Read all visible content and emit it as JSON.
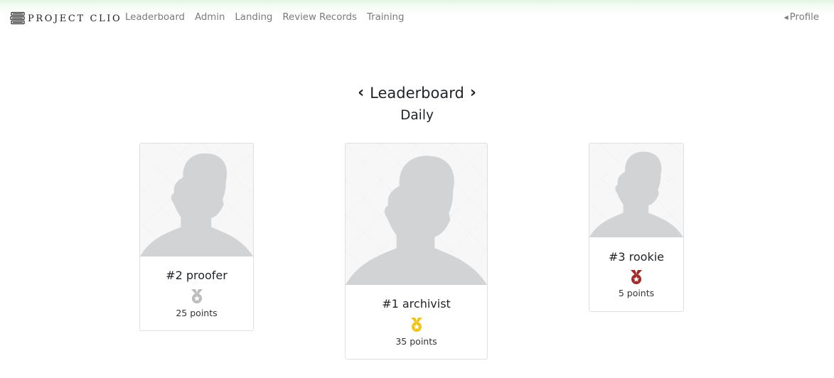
{
  "nav": {
    "brand": "PROJECT CLIO",
    "links": [
      "Leaderboard",
      "Admin",
      "Landing",
      "Review Records",
      "Training"
    ],
    "profile": "Profile"
  },
  "main": {
    "title": "Leaderboard",
    "subtitle": "Daily"
  },
  "leaderboard": [
    {
      "rank_label": "#2 proofer",
      "points_label": "25 points",
      "medal_color": "#bbbbbb"
    },
    {
      "rank_label": "#1 archivist",
      "points_label": "35 points",
      "medal_color": "#f0c419"
    },
    {
      "rank_label": "#3 rookie",
      "points_label": "5 points",
      "medal_color": "#a32a2a"
    }
  ]
}
